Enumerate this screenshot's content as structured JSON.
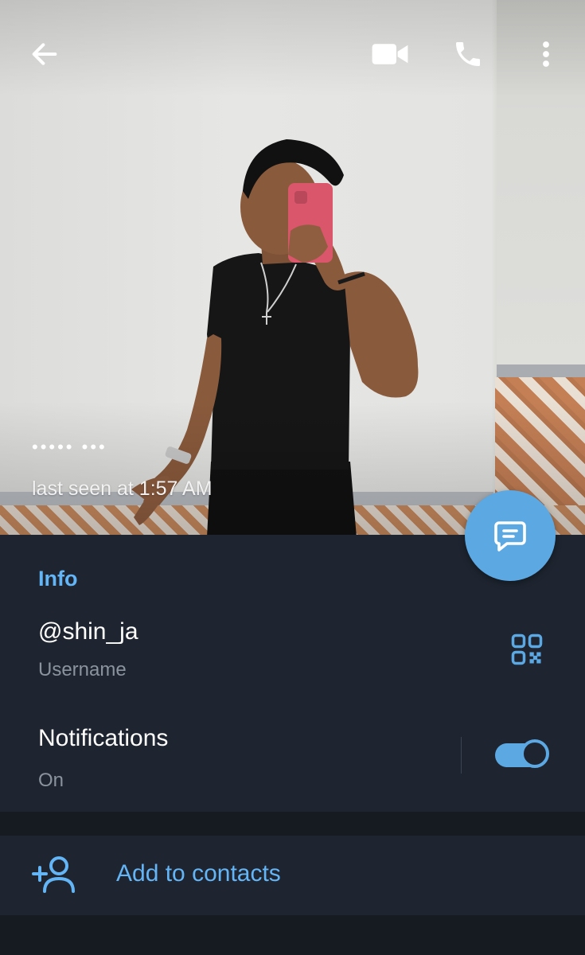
{
  "colors": {
    "accent": "#5ba8e3",
    "accent_text": "#64b5f6",
    "panel_bg": "#1e2530",
    "secondary_text": "#8a939e"
  },
  "header": {
    "back_icon": "arrow-left-icon",
    "actions": [
      {
        "name": "video-call-button",
        "icon": "video-camera-icon"
      },
      {
        "name": "voice-call-button",
        "icon": "phone-icon"
      },
      {
        "name": "more-options-button",
        "icon": "more-vertical-icon"
      }
    ]
  },
  "profile": {
    "name": "••••• •••",
    "status": "last seen at 1:57 AM"
  },
  "fab": {
    "icon": "message-icon"
  },
  "info": {
    "title": "Info",
    "username": "@shin_ja",
    "username_label": "Username",
    "qr_icon": "qr-code-icon",
    "notifications_label": "Notifications",
    "notifications_state": "On",
    "notifications_enabled": true
  },
  "actions": {
    "add_contact_label": "Add to contacts",
    "add_contact_icon": "add-user-icon"
  }
}
